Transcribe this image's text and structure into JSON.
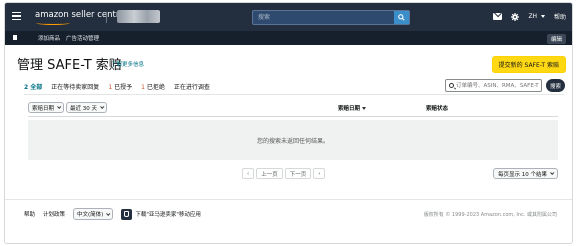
{
  "header": {
    "brand": "amazon seller central",
    "search_placeholder": "搜索",
    "language": "ZH",
    "help": "帮助"
  },
  "subnav": {
    "links": [
      "添加商品",
      "广告活动管理"
    ],
    "edit": "编辑"
  },
  "page": {
    "title": "管理 SAFE-T 索赔",
    "learn_more": "了解更多信息",
    "new_claim": "提交新的 SAFE-T 索赔"
  },
  "tabs": [
    {
      "count": "2",
      "label": "全部",
      "active": true
    },
    {
      "count": "",
      "label": "正在等待卖家回复",
      "active": false
    },
    {
      "count": "1",
      "label": "已授予",
      "active": false
    },
    {
      "count": "1",
      "label": "已拒绝",
      "active": false
    },
    {
      "count": "",
      "label": "正在进行调查",
      "active": false
    }
  ],
  "filter": {
    "placeholder": "订单编号、ASIN、RMA、SAFE-T",
    "search_button": "搜索"
  },
  "table": {
    "filter_date": "索赔日期",
    "filter_range": "最近 30 天",
    "columns": [
      "索赔日期",
      "索赔状态"
    ],
    "empty_message": "您的搜索未返回任何结果。"
  },
  "pagination": {
    "prev": "上一页",
    "next": "下一页",
    "per_page": "每页显示 10 个结果"
  },
  "footer": {
    "help": "帮助",
    "policies": "计划政策",
    "language": "中文(简体)",
    "app": "下载\"亚马逊卖家\"移动应用",
    "copyright": "版权所有 © 1999-2023 Amazon.com, Inc. 或其附属公司"
  }
}
